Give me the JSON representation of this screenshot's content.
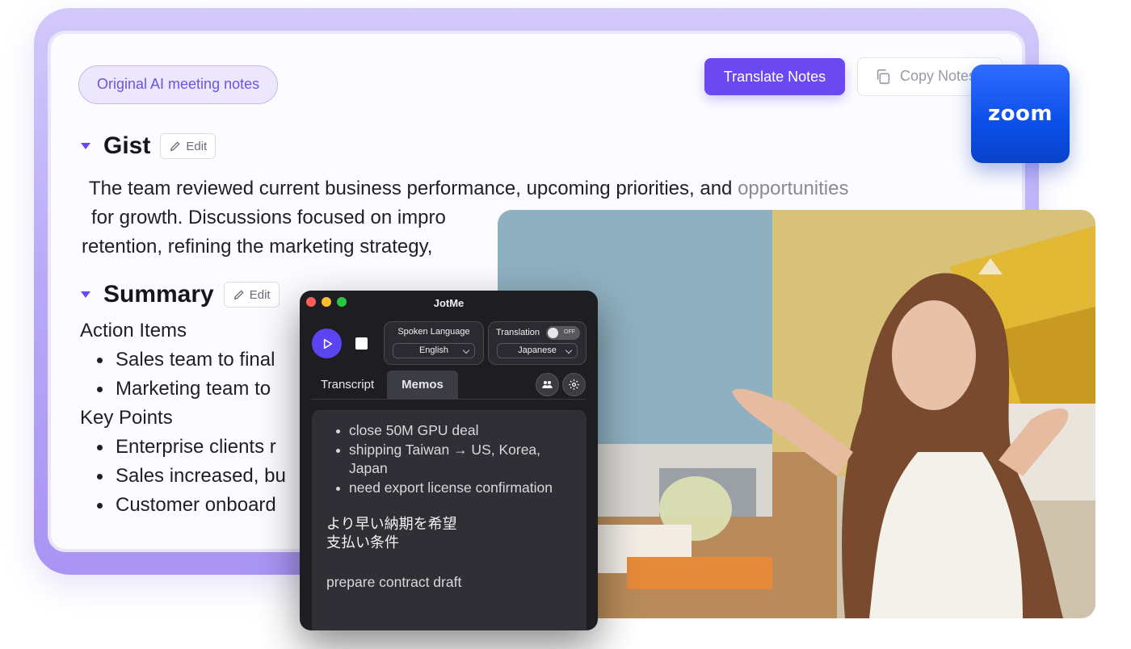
{
  "notes": {
    "original_chip": "Original AI meeting notes",
    "translate_button": "Translate Notes",
    "copy_button": "Copy Notes",
    "accent_color": "#6b49f0",
    "gist": {
      "title": "Gist",
      "edit_label": "Edit",
      "lines": [
        {
          "main": "The team reviewed current business performance, upcoming priorities, and ",
          "faded": "opportunities"
        },
        {
          "main": "for growth. Discussions focused on impro",
          "faded": ""
        },
        {
          "main": "retention, refining the marketing strategy,",
          "faded": ""
        }
      ]
    },
    "summary": {
      "title": "Summary",
      "edit_label": "Edit",
      "action_items_label": "Action Items",
      "action_items": [
        "Sales team to final",
        "Marketing team to"
      ],
      "key_points_label": "Key Points",
      "key_points": [
        "Enterprise clients r",
        "Sales increased, bu",
        "Customer onboard"
      ]
    }
  },
  "zoom_badge": {
    "label": "zoom",
    "color": "#0b5cff"
  },
  "jotme": {
    "title": "JotMe",
    "spoken_language": {
      "label": "Spoken Language",
      "value": "English"
    },
    "translation": {
      "label": "Translation",
      "toggle_state": "OFF",
      "value": "Japanese"
    },
    "tabs": [
      {
        "label": "Transcript",
        "active": false
      },
      {
        "label": "Memos",
        "active": true
      }
    ],
    "memo": {
      "bullets": [
        "close 50M GPU deal",
        "shipping Taiwan → US, Korea, Japan",
        "need export license confirmation"
      ],
      "japanese_lines": [
        "より早い納期を希望",
        "支払い条件"
      ],
      "draft_line": "prepare contract draft"
    }
  }
}
